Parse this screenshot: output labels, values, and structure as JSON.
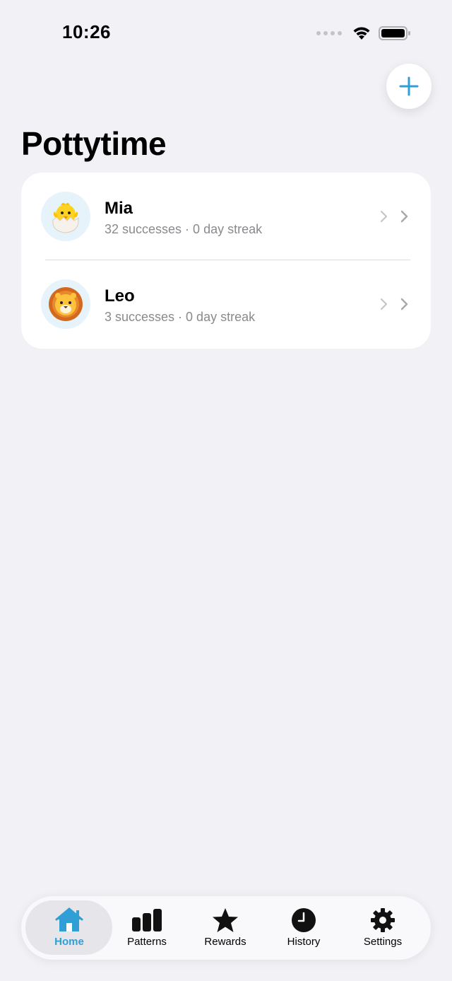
{
  "status_bar": {
    "time": "10:26"
  },
  "header": {
    "title": "Pottytime",
    "add_button_icon": "plus-icon",
    "accent_color": "#2f9fd6"
  },
  "children": [
    {
      "name": "Mia",
      "stats": "32 successes · 0 day streak",
      "avatar_icon": "hatching-chick-icon"
    },
    {
      "name": "Leo",
      "stats": "3 successes · 0 day streak",
      "avatar_icon": "lion-face-icon"
    }
  ],
  "tab_bar": {
    "active": "Home",
    "tabs": [
      {
        "label": "Home",
        "icon": "house-icon"
      },
      {
        "label": "Patterns",
        "icon": "bar-chart-icon"
      },
      {
        "label": "Rewards",
        "icon": "star-icon"
      },
      {
        "label": "History",
        "icon": "clock-icon"
      },
      {
        "label": "Settings",
        "icon": "gear-icon"
      }
    ]
  }
}
